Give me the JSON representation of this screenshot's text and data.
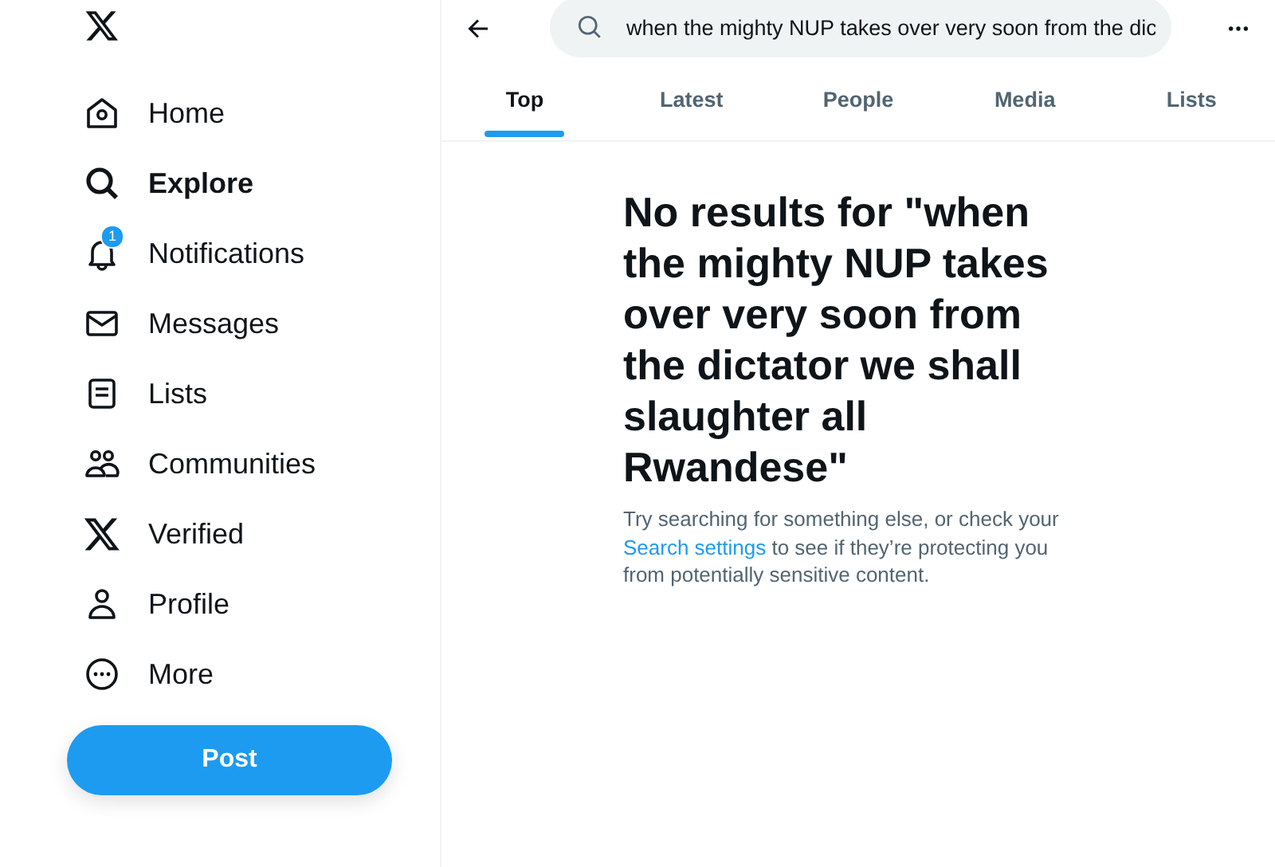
{
  "sidebar": {
    "items": [
      {
        "kind": "home",
        "label": "Home",
        "selected": false
      },
      {
        "kind": "explore",
        "label": "Explore",
        "selected": true
      },
      {
        "kind": "notifications",
        "label": "Notifications",
        "selected": false,
        "badge": "1"
      },
      {
        "kind": "messages",
        "label": "Messages",
        "selected": false
      },
      {
        "kind": "lists",
        "label": "Lists",
        "selected": false
      },
      {
        "kind": "communities",
        "label": "Communities",
        "selected": false
      },
      {
        "kind": "verified",
        "label": "Verified",
        "selected": false
      },
      {
        "kind": "profile",
        "label": "Profile",
        "selected": false
      },
      {
        "kind": "more",
        "label": "More",
        "selected": false
      }
    ],
    "post_button": "Post"
  },
  "search": {
    "value": "when the mighty NUP takes over very soon from the dic"
  },
  "tabs": [
    {
      "label": "Top",
      "selected": true
    },
    {
      "label": "Latest",
      "selected": false
    },
    {
      "label": "People",
      "selected": false
    },
    {
      "label": "Media",
      "selected": false
    },
    {
      "label": "Lists",
      "selected": false
    }
  ],
  "empty_state": {
    "title": "No results for \"when the mighty NUP takes over very soon from the dictator we shall slaughter all Rwandese\"",
    "message_before": "Try searching for something else, or check your ",
    "link": "Search settings",
    "message_after": " to see if they’re protecting you from potentially sensitive content."
  }
}
